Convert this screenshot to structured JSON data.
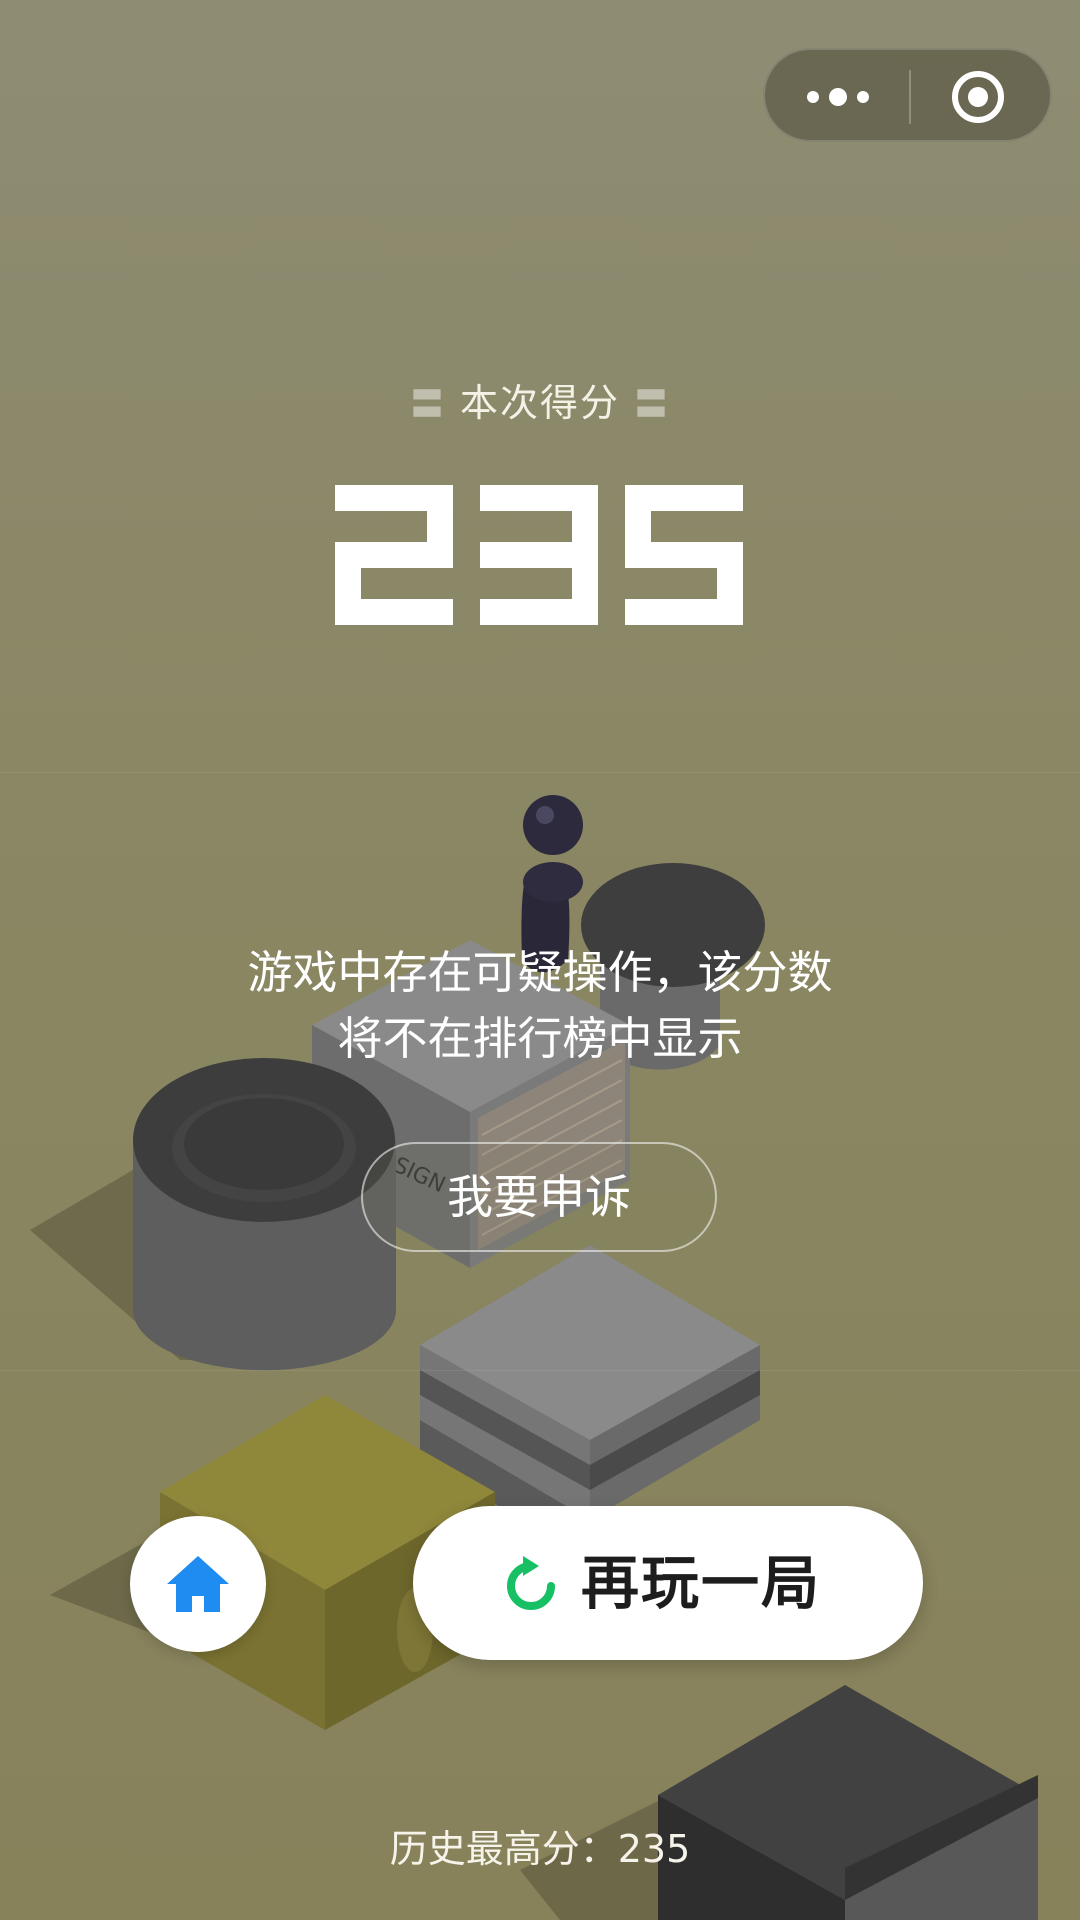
{
  "top_bar": {
    "more_icon": "more-dots-icon",
    "close_icon": "target-close-icon"
  },
  "score": {
    "label": "本次得分",
    "deco_left": "〓",
    "deco_right": "〓",
    "value": "235"
  },
  "notice": {
    "line1": "游戏中存在可疑操作，该分数",
    "line2": "将不在排行榜中显示"
  },
  "appeal_button": {
    "label": "我要申诉"
  },
  "home_button": {
    "icon": "home-icon",
    "color": "#1e8cf0"
  },
  "replay_button": {
    "label": "再玩一局",
    "icon": "refresh-icon",
    "icon_color": "#18c065"
  },
  "best_score": {
    "text": "历史最高分：235"
  },
  "scene": {
    "block_text": "SIGN"
  },
  "colors": {
    "background": "#8a8764",
    "accent_green": "#18c065",
    "accent_blue": "#1e8cf0"
  }
}
